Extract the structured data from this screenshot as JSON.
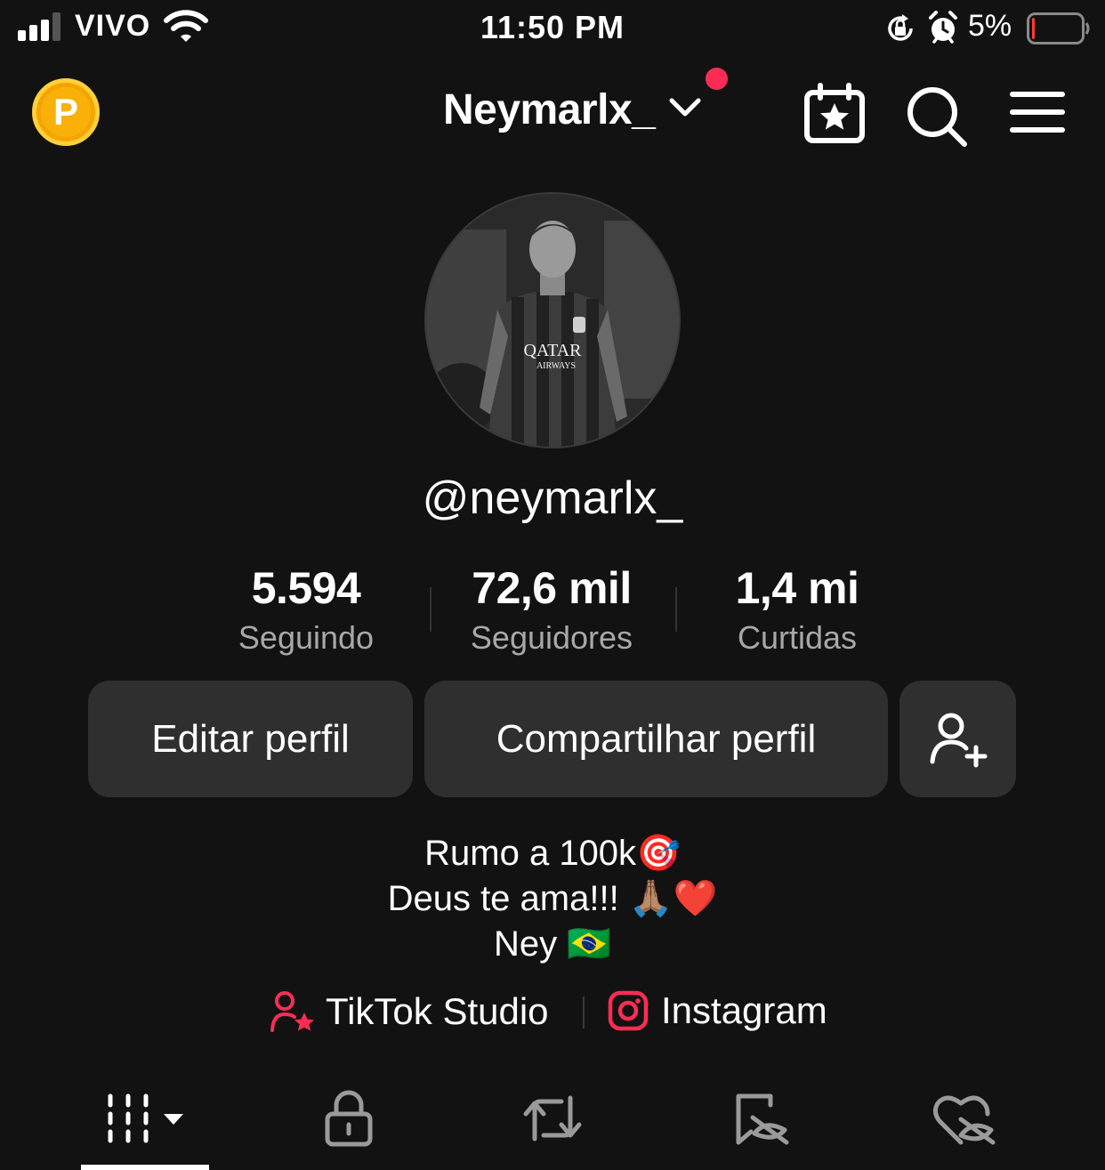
{
  "status_bar": {
    "carrier": "VIVO",
    "time": "11:50 PM",
    "battery_percent": "5%",
    "battery_level": 0.05,
    "icons": [
      "cellular-signal-icon",
      "wifi-icon",
      "rotation-lock-icon",
      "alarm-icon",
      "battery-icon"
    ]
  },
  "header": {
    "coin_letter": "P",
    "account_name": "Neymarlx_",
    "has_notification_dot": true,
    "icons": [
      "coin-icon",
      "chevron-down-icon",
      "calendar-star-icon",
      "search-icon",
      "menu-icon"
    ]
  },
  "profile": {
    "handle": "@neymarlx_",
    "avatar_desc_icon": "avatar"
  },
  "stats": [
    {
      "value": "5.594",
      "label": "Seguindo"
    },
    {
      "value": "72,6 mil",
      "label": "Seguidores"
    },
    {
      "value": "1,4 mi",
      "label": "Curtidas"
    }
  ],
  "actions": {
    "edit_profile": "Editar perfil",
    "share_profile": "Compartilhar perfil",
    "add_friend_icon": "add-user-icon"
  },
  "bio": {
    "line1": "Rumo a 100k🎯",
    "line2": "Deus te ama!!! 🙏🏽❤️",
    "line3": "Ney 🇧🇷"
  },
  "links": {
    "studio": "TikTok Studio",
    "instagram": "Instagram"
  },
  "tabs": [
    {
      "name": "videos",
      "icon": "grid-icon",
      "selected": true
    },
    {
      "name": "private",
      "icon": "lock-icon",
      "selected": false
    },
    {
      "name": "reposts",
      "icon": "repost-icon",
      "selected": false
    },
    {
      "name": "favorites",
      "icon": "bookmark-hidden-icon",
      "selected": false
    },
    {
      "name": "liked",
      "icon": "heart-hidden-icon",
      "selected": false
    }
  ],
  "colors": {
    "background": "#121212",
    "button": "#2f2f2f",
    "accent_red": "#fe2c55",
    "coin": "#f9b10a",
    "secondary_text": "#a8a8a8"
  }
}
